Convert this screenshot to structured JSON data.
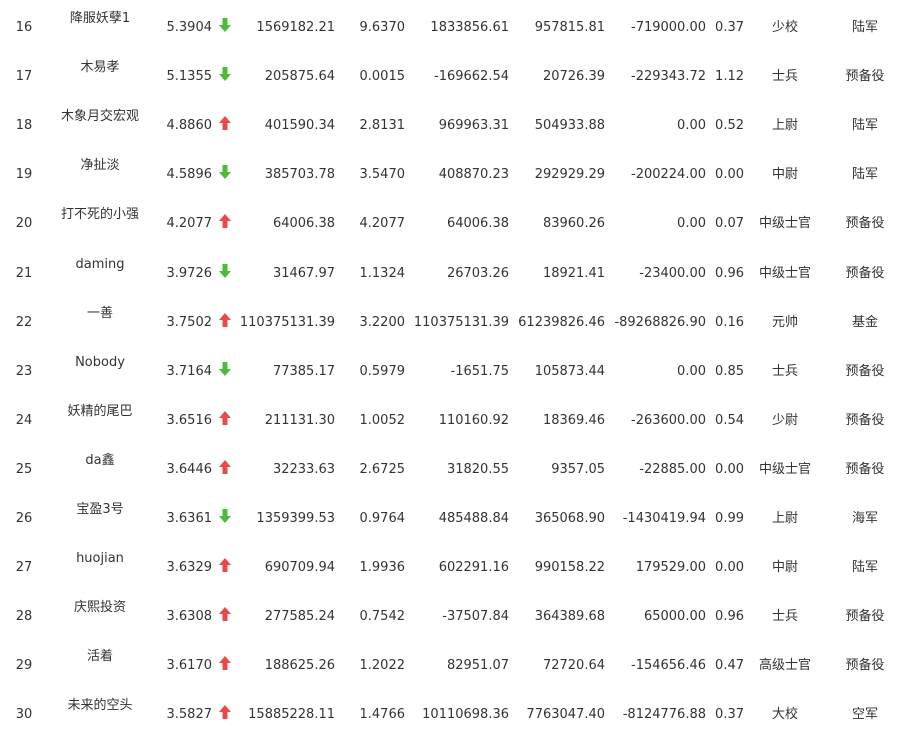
{
  "rows": [
    {
      "rank": "16",
      "name": "降服妖孽1",
      "score": "5.3904",
      "trend": "down",
      "c1": "1569182.21",
      "c2": "9.6370",
      "c3": "1833856.61",
      "c4": "957815.81",
      "c5": "-719000.00",
      "c6": "0.37",
      "military_rank": "少校",
      "branch": "陆军"
    },
    {
      "rank": "17",
      "name": "木易孝",
      "score": "5.1355",
      "trend": "down",
      "c1": "205875.64",
      "c2": "0.0015",
      "c3": "-169662.54",
      "c4": "20726.39",
      "c5": "-229343.72",
      "c6": "1.12",
      "military_rank": "士兵",
      "branch": "预备役"
    },
    {
      "rank": "18",
      "name": "木象月交宏观",
      "score": "4.8860",
      "trend": "up",
      "c1": "401590.34",
      "c2": "2.8131",
      "c3": "969963.31",
      "c4": "504933.88",
      "c5": "0.00",
      "c6": "0.52",
      "military_rank": "上尉",
      "branch": "陆军"
    },
    {
      "rank": "19",
      "name": "净扯淡",
      "score": "4.5896",
      "trend": "down",
      "c1": "385703.78",
      "c2": "3.5470",
      "c3": "408870.23",
      "c4": "292929.29",
      "c5": "-200224.00",
      "c6": "0.00",
      "military_rank": "中尉",
      "branch": "陆军"
    },
    {
      "rank": "20",
      "name": "打不死的小强",
      "score": "4.2077",
      "trend": "up",
      "c1": "64006.38",
      "c2": "4.2077",
      "c3": "64006.38",
      "c4": "83960.26",
      "c5": "0.00",
      "c6": "0.07",
      "military_rank": "中级士官",
      "branch": "预备役"
    },
    {
      "rank": "21",
      "name": "daming",
      "score": "3.9726",
      "trend": "down",
      "c1": "31467.97",
      "c2": "1.1324",
      "c3": "26703.26",
      "c4": "18921.41",
      "c5": "-23400.00",
      "c6": "0.96",
      "military_rank": "中级士官",
      "branch": "预备役"
    },
    {
      "rank": "22",
      "name": "一善",
      "score": "3.7502",
      "trend": "up",
      "c1": "110375131.39",
      "c2": "3.2200",
      "c3": "110375131.39",
      "c4": "61239826.46",
      "c5": "-89268826.90",
      "c6": "0.16",
      "military_rank": "元帅",
      "branch": "基金"
    },
    {
      "rank": "23",
      "name": "Nobody",
      "score": "3.7164",
      "trend": "down",
      "c1": "77385.17",
      "c2": "0.5979",
      "c3": "-1651.75",
      "c4": "105873.44",
      "c5": "0.00",
      "c6": "0.85",
      "military_rank": "士兵",
      "branch": "预备役"
    },
    {
      "rank": "24",
      "name": "妖精的尾巴",
      "score": "3.6516",
      "trend": "up",
      "c1": "211131.30",
      "c2": "1.0052",
      "c3": "110160.92",
      "c4": "18369.46",
      "c5": "-263600.00",
      "c6": "0.54",
      "military_rank": "少尉",
      "branch": "预备役"
    },
    {
      "rank": "25",
      "name": "da鑫",
      "score": "3.6446",
      "trend": "up",
      "c1": "32233.63",
      "c2": "2.6725",
      "c3": "31820.55",
      "c4": "9357.05",
      "c5": "-22885.00",
      "c6": "0.00",
      "military_rank": "中级士官",
      "branch": "预备役"
    },
    {
      "rank": "26",
      "name": "宝盈3号",
      "score": "3.6361",
      "trend": "down",
      "c1": "1359399.53",
      "c2": "0.9764",
      "c3": "485488.84",
      "c4": "365068.90",
      "c5": "-1430419.94",
      "c6": "0.99",
      "military_rank": "上尉",
      "branch": "海军"
    },
    {
      "rank": "27",
      "name": "huojian",
      "score": "3.6329",
      "trend": "up",
      "c1": "690709.94",
      "c2": "1.9936",
      "c3": "602291.16",
      "c4": "990158.22",
      "c5": "179529.00",
      "c6": "0.00",
      "military_rank": "中尉",
      "branch": "陆军"
    },
    {
      "rank": "28",
      "name": "庆熙投资",
      "score": "3.6308",
      "trend": "up",
      "c1": "277585.24",
      "c2": "0.7542",
      "c3": "-37507.84",
      "c4": "364389.68",
      "c5": "65000.00",
      "c6": "0.96",
      "military_rank": "士兵",
      "branch": "预备役"
    },
    {
      "rank": "29",
      "name": "活着",
      "score": "3.6170",
      "trend": "up",
      "c1": "188625.26",
      "c2": "1.2022",
      "c3": "82951.07",
      "c4": "72720.64",
      "c5": "-154656.46",
      "c6": "0.47",
      "military_rank": "高级士官",
      "branch": "预备役"
    },
    {
      "rank": "30",
      "name": "未来的空头",
      "score": "3.5827",
      "trend": "up",
      "c1": "15885228.11",
      "c2": "1.4766",
      "c3": "10110698.36",
      "c4": "7763047.40",
      "c5": "-8124776.88",
      "c6": "0.37",
      "military_rank": "大校",
      "branch": "空军"
    }
  ],
  "colors": {
    "up_arrow": "#e84a4a",
    "down_arrow": "#4cbb3a",
    "text": "#333333",
    "background": "#ffffff"
  }
}
